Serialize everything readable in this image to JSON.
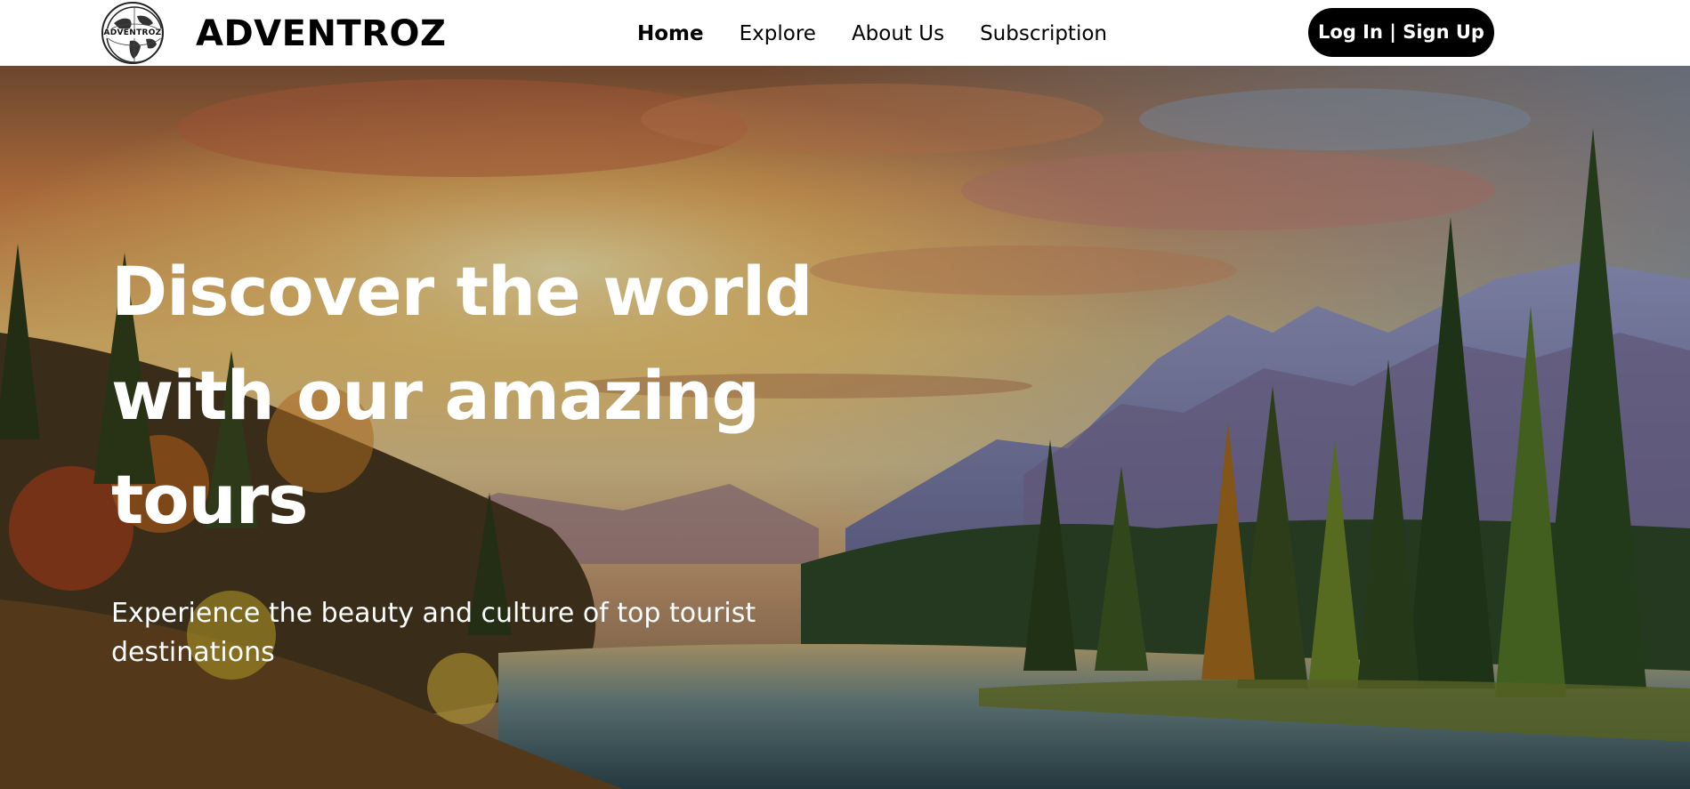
{
  "brand": {
    "name": "ADVENTROZ",
    "badge_text": "ADVENTROZ"
  },
  "nav": {
    "links": [
      {
        "label": "Home",
        "active": true
      },
      {
        "label": "Explore",
        "active": false
      },
      {
        "label": "About Us",
        "active": false
      },
      {
        "label": "Subscription",
        "active": false
      }
    ],
    "auth_button_label": "Log In | Sign Up"
  },
  "hero": {
    "title": "Discover the world with our amazing tours",
    "subtitle": "Experience the beauty and culture of top tourist destinations",
    "background": "painted-landscape-sunset-mountains-lake-forest"
  },
  "colors": {
    "nav_bg": "#ffffff",
    "text_dark": "#000000",
    "button_bg": "#000000",
    "button_text": "#ffffff",
    "hero_text": "#ffffff"
  }
}
